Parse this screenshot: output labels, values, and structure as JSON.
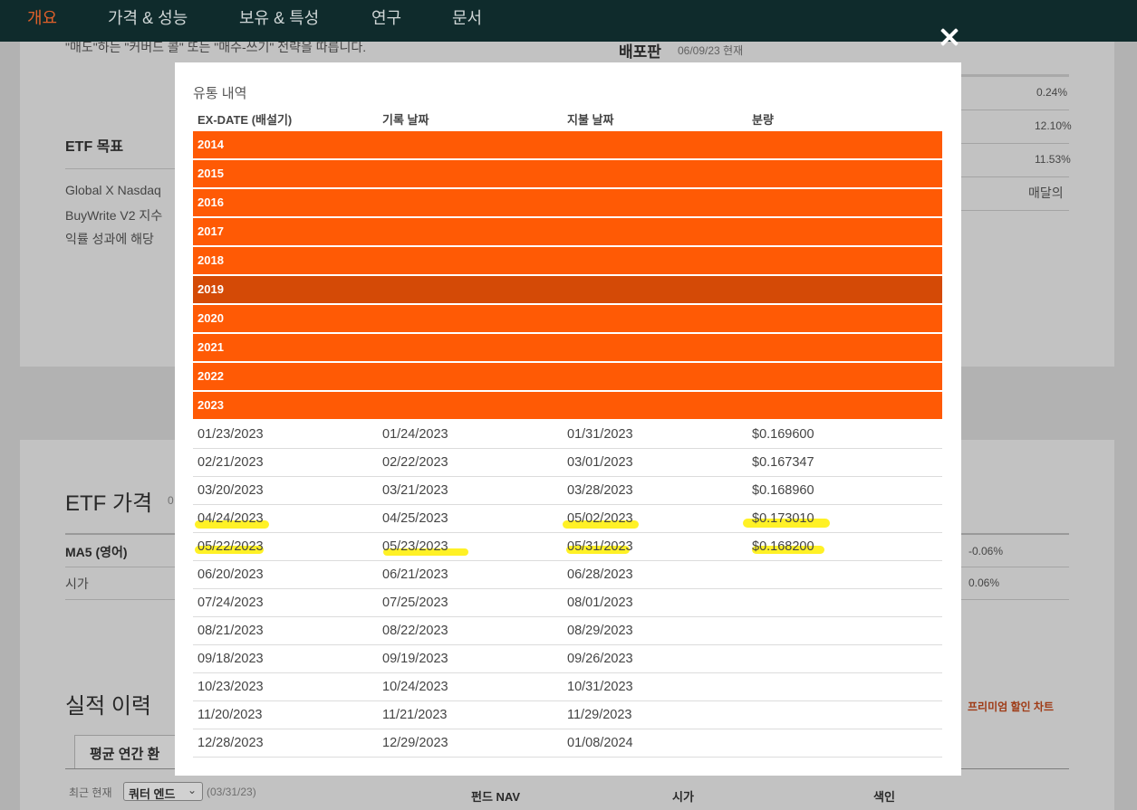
{
  "nav": {
    "items": [
      "개요",
      "가격 & 성능",
      "보유 & 특성",
      "연구",
      "문서"
    ]
  },
  "background": {
    "top_cut_text": "\"매도\"하는 \"커버드 콜\" 또는 \"매수-쓰기\" 전략을 따릅니다.",
    "dist_heading": "배포판",
    "dist_asof": "06/09/23 현재",
    "right_values": [
      "0.24%",
      "12.10%",
      "11.53%",
      "매달의"
    ],
    "etf_goal_title": "ETF 목표",
    "goal_lines": [
      "Global X Nasdaq",
      "BuyWrite V2 지수",
      "익률 성과에 해당"
    ],
    "etf_price_title": "ETF 가격",
    "etf_price_sub": "0",
    "price_rows": [
      {
        "label": "MA5 (영어)",
        "value": "-0.06%"
      },
      {
        "label": "시가",
        "value": "0.06%"
      }
    ],
    "perf_title": "실적 이력",
    "perf_link": "프리미엄 할인 차트",
    "perf_tab": "평균 연간 환",
    "recent_label": "최근 현재",
    "quarter_select": "쿼터 엔드",
    "quarter_date": "(03/31/23)",
    "table_cols": [
      "펀드 NAV",
      "시가",
      "색인"
    ]
  },
  "modal": {
    "title": "유통 내역",
    "columns": [
      "EX-DATE (배설기)",
      "기록 날짜",
      "지불 날짜",
      "분량"
    ],
    "years": [
      "2014",
      "2015",
      "2016",
      "2017",
      "2018",
      "2019",
      "2020",
      "2021",
      "2022",
      "2023"
    ],
    "hover_year": "2019",
    "rows": [
      {
        "ex": "01/23/2023",
        "record": "01/24/2023",
        "pay": "01/31/2023",
        "amount": "$0.169600"
      },
      {
        "ex": "02/21/2023",
        "record": "02/22/2023",
        "pay": "03/01/2023",
        "amount": "$0.167347"
      },
      {
        "ex": "03/20/2023",
        "record": "03/21/2023",
        "pay": "03/28/2023",
        "amount": "$0.168960"
      },
      {
        "ex": "04/24/2023",
        "record": "04/25/2023",
        "pay": "05/02/2023",
        "amount": "$0.173010"
      },
      {
        "ex": "05/22/2023",
        "record": "05/23/2023",
        "pay": "05/31/2023",
        "amount": "$0.168200"
      },
      {
        "ex": "06/20/2023",
        "record": "06/21/2023",
        "pay": "06/28/2023",
        "amount": ""
      },
      {
        "ex": "07/24/2023",
        "record": "07/25/2023",
        "pay": "08/01/2023",
        "amount": ""
      },
      {
        "ex": "08/21/2023",
        "record": "08/22/2023",
        "pay": "08/29/2023",
        "amount": ""
      },
      {
        "ex": "09/18/2023",
        "record": "09/19/2023",
        "pay": "09/26/2023",
        "amount": ""
      },
      {
        "ex": "10/23/2023",
        "record": "10/24/2023",
        "pay": "10/31/2023",
        "amount": ""
      },
      {
        "ex": "11/20/2023",
        "record": "11/21/2023",
        "pay": "11/29/2023",
        "amount": ""
      },
      {
        "ex": "12/28/2023",
        "record": "12/29/2023",
        "pay": "01/08/2024",
        "amount": ""
      }
    ]
  },
  "colors": {
    "year_bar": "#ff5a05",
    "year_bar_hover": "#d44a06",
    "highlight": "#ffef00",
    "nav_bg": "#0f2b2c",
    "nav_active": "#e0602a"
  }
}
